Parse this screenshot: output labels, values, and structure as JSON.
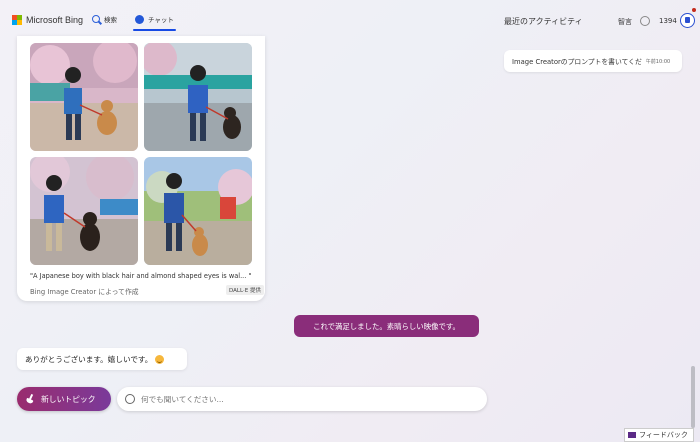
{
  "header": {
    "brand": "Microsoft Bing",
    "nav": [
      {
        "label": "検索",
        "icon": "search-icon"
      },
      {
        "label": "チャット",
        "icon": "chat-icon",
        "active": true
      }
    ],
    "activity_title": "最近のアクティビティ",
    "language": "智言",
    "points": "1394"
  },
  "image_result": {
    "caption": "\"A Japanese boy with black hair and almond shaped eyes is wal... \"",
    "creator": "Bing Image Creator によって作成",
    "badge": "DALL·E 提供",
    "images": [
      "boy-with-dog-1",
      "boy-with-dog-2",
      "boy-with-dog-3",
      "boy-with-dog-4"
    ]
  },
  "messages": {
    "user": "これで満足しました。素晴らしい映像です。",
    "bot": "ありがとうございます。嬉しいです。"
  },
  "composer": {
    "new_topic": "新しいトピック",
    "placeholder": "何でも聞いてください..."
  },
  "activity": {
    "items": [
      {
        "title": "Image Creatorのプロンプトを書いてくだ",
        "time": "午前10:00"
      }
    ]
  },
  "feedback": "フィードバック",
  "colors": {
    "accent": "#8a2d7a",
    "topic_button": "#9a2c6e",
    "nav_underline": "#174ae4"
  }
}
